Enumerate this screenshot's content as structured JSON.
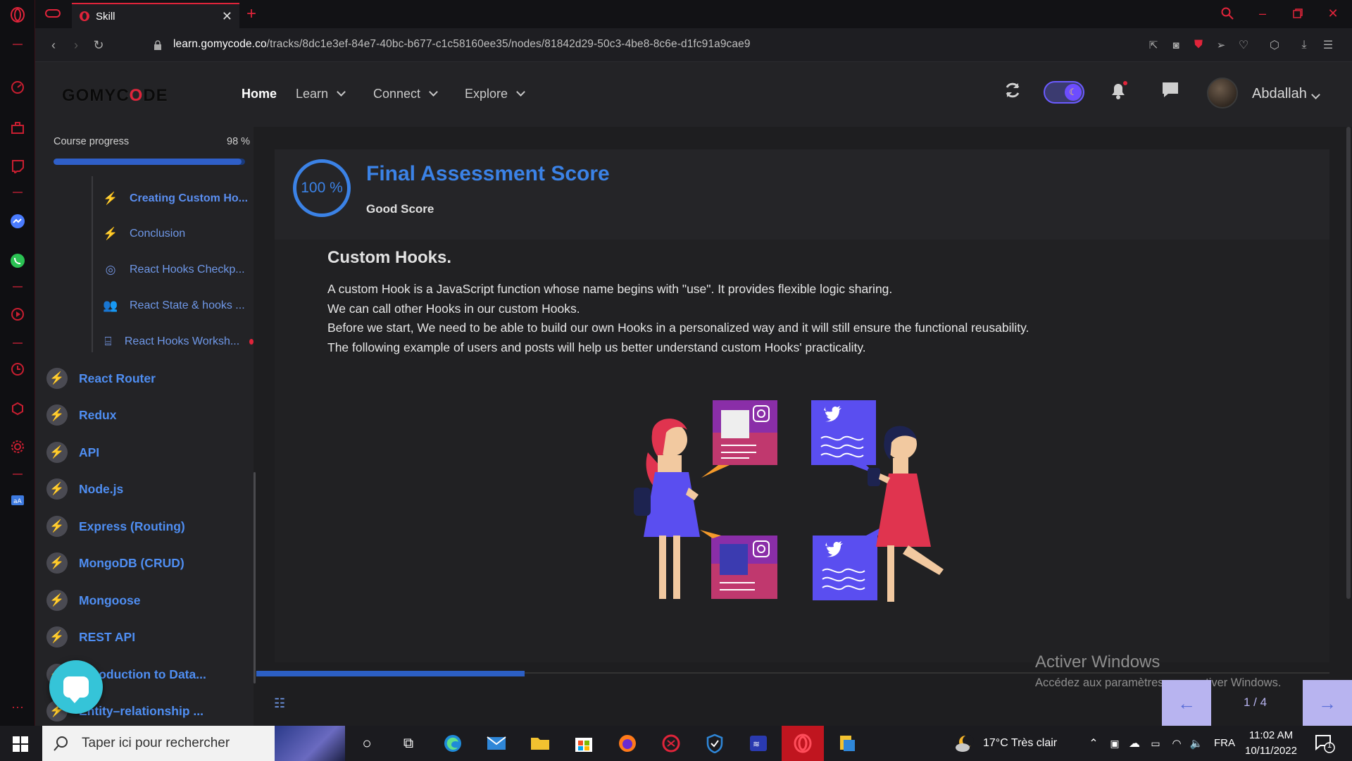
{
  "browser": {
    "tab_title": "Skill",
    "url_domain": "learn.gomycode.co",
    "url_path": "/tracks/8dc1e3ef-84e7-40bc-b677-c1c58160ee35/nodes/81842d29-50c3-4be8-8c6e-d1fc91a9cae9",
    "accent_color": "#e0243a"
  },
  "header": {
    "logo_prefix": "GOMYC",
    "logo_o": "O",
    "logo_suffix": "DE",
    "nav": [
      {
        "label": "Home"
      },
      {
        "label": "Learn"
      },
      {
        "label": "Connect"
      },
      {
        "label": "Explore"
      }
    ],
    "username": "Abdallah",
    "icons": [
      "refresh-icon",
      "dark-mode-toggle",
      "bell-icon",
      "chat-icon"
    ]
  },
  "sidebar": {
    "progress_label": "Course progress",
    "progress_value": "98 %",
    "progress_fraction": 0.98,
    "sub_items": [
      {
        "label": "Creating Custom Ho...",
        "icon": "bolt-icon",
        "current": true
      },
      {
        "label": "Conclusion",
        "icon": "bolt-icon"
      },
      {
        "label": "React Hooks Checkp...",
        "icon": "target-icon"
      },
      {
        "label": "React State & hooks ...",
        "icon": "people-icon"
      },
      {
        "label": "React Hooks Worksh...",
        "icon": "workshop-icon",
        "badge": true
      }
    ],
    "modules": [
      {
        "label": "React Router"
      },
      {
        "label": "Redux"
      },
      {
        "label": "API"
      },
      {
        "label": "Node.js"
      },
      {
        "label": "Express (Routing)"
      },
      {
        "label": "MongoDB (CRUD)"
      },
      {
        "label": "Mongoose"
      },
      {
        "label": "REST API"
      },
      {
        "label": "Introduction to Data..."
      },
      {
        "label": "Entity–relationship ..."
      }
    ]
  },
  "score": {
    "value": "100 %",
    "title": "Final Assessment Score",
    "subtitle": "Good Score",
    "color": "#3b82e6"
  },
  "lesson": {
    "title": "Custom Hooks.",
    "paragraphs": [
      "A custom Hook is a JavaScript function whose name begins with \"use\". It provides flexible logic sharing.",
      "We can call other Hooks in our custom Hooks.",
      "Before we start, We need to be able to build our own Hooks in a personalized way and it will still ensure the functional reusability.",
      "The following example of users and posts will help us better understand custom Hooks' practicality."
    ]
  },
  "pager": {
    "text": "1 / 4",
    "slide_fraction": 0.25
  },
  "watermark": {
    "line1": "Activer Windows",
    "line2": "Accédez aux paramètres pour activer Windows."
  },
  "taskbar": {
    "search_placeholder": "Taper ici pour rechercher",
    "weather": "17°C  Très clair",
    "lang": "FRA",
    "time": "11:02 AM",
    "date": "10/11/2022",
    "notifications": "1"
  }
}
